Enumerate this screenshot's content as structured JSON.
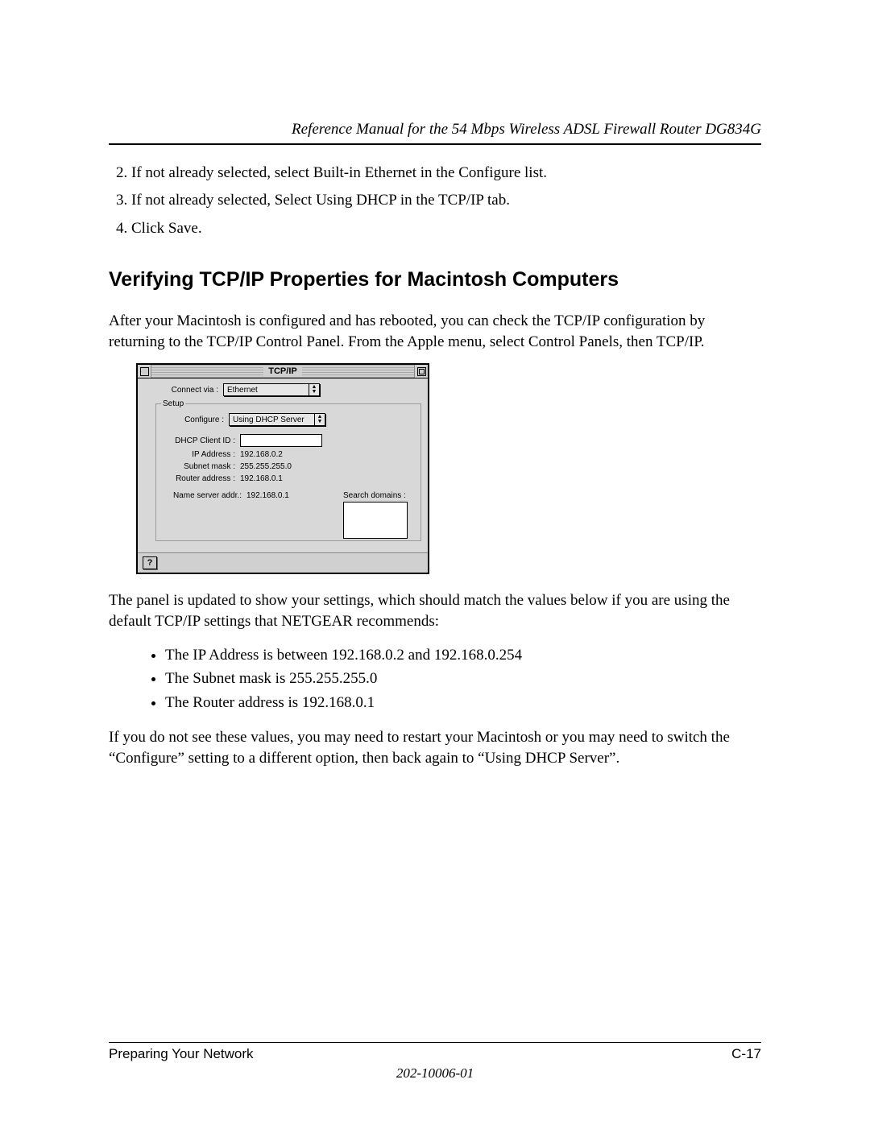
{
  "header": {
    "running_title": "Reference Manual for the 54 Mbps Wireless ADSL Firewall Router DG834G"
  },
  "steps": {
    "s2": "If not already selected, select Built-in Ethernet in the Configure list.",
    "s3": "If not already selected, Select Using DHCP in the TCP/IP tab.",
    "s4": "Click Save."
  },
  "section_heading": "Verifying TCP/IP Properties for Macintosh Computers",
  "intro_para": "After your Macintosh is configured and has rebooted, you can check the TCP/IP configuration by returning to the TCP/IP Control Panel. From the Apple menu, select Control Panels, then TCP/IP.",
  "tcpip_panel": {
    "title": "TCP/IP",
    "connect_via_label": "Connect via :",
    "connect_via_value": "Ethernet",
    "setup_legend": "Setup",
    "configure_label": "Configure :",
    "configure_value": "Using DHCP Server",
    "dhcp_client_id_label": "DHCP Client ID :",
    "dhcp_client_id_value": "",
    "ip_address_label": "IP Address :",
    "ip_address_value": "192.168.0.2",
    "subnet_mask_label": "Subnet mask :",
    "subnet_mask_value": "255.255.255.0",
    "router_address_label": "Router address :",
    "router_address_value": "192.168.0.1",
    "name_server_label": "Name server addr.:",
    "name_server_value": "192.168.0.1",
    "search_domains_label": "Search domains :",
    "help_symbol": "?"
  },
  "after_para": "The panel is updated to show your settings, which should match the values below if you are using the default TCP/IP settings that NETGEAR recommends:",
  "bullets": {
    "b1": "The IP Address is between 192.168.0.2 and 192.168.0.254",
    "b2": "The Subnet mask is 255.255.255.0",
    "b3": "The Router address is 192.168.0.1"
  },
  "closing_para": "If you do not see these values, you may need to restart your Macintosh or you may need to switch the “Configure” setting to a different option, then back again to “Using DHCP Server”.",
  "footer": {
    "section": "Preparing Your Network",
    "page": "C-17",
    "docnum": "202-10006-01"
  }
}
